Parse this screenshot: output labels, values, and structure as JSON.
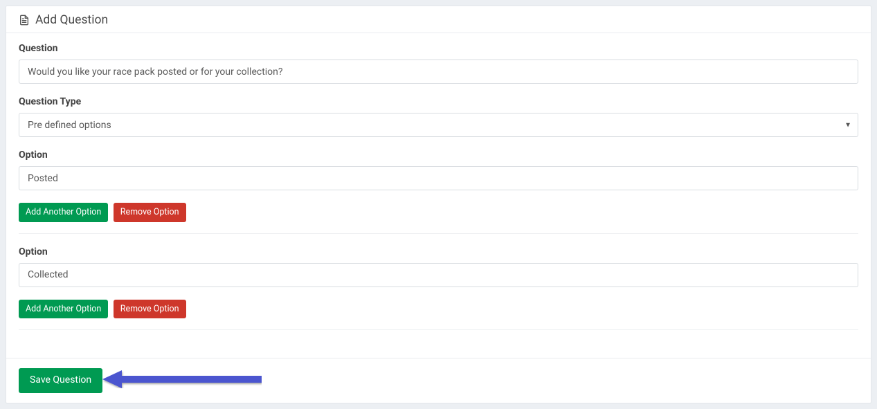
{
  "header": {
    "title": "Add Question"
  },
  "form": {
    "question_label": "Question",
    "question_value": "Would you like your race pack posted or for your collection?",
    "type_label": "Question Type",
    "type_selected": "Pre defined options",
    "option_label": "Option",
    "add_option_label": "Add Another Option",
    "remove_option_label": "Remove Option",
    "save_label": "Save Question"
  },
  "options": [
    {
      "value": "Posted"
    },
    {
      "value": "Collected"
    }
  ]
}
